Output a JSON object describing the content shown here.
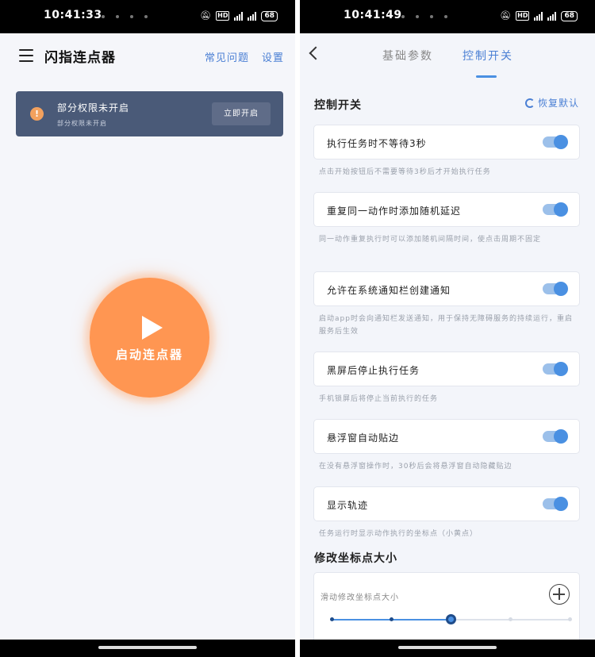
{
  "left": {
    "status": {
      "time": "10:41:33",
      "battery": "68",
      "hd": "HD"
    },
    "header": {
      "title": "闪指连点器",
      "faq": "常见问题",
      "settings": "设置"
    },
    "banner": {
      "title": "部分权限未开启",
      "subtitle": "部分权限未开启",
      "button": "立即开启",
      "icon": "!"
    },
    "start_button": {
      "label": "启动连点器"
    }
  },
  "right": {
    "status": {
      "time": "10:41:49",
      "battery": "68",
      "hd": "HD"
    },
    "tabs": [
      {
        "label": "基础参数"
      },
      {
        "label": "控制开关"
      }
    ],
    "section_control": "控制开关",
    "restore_label": "恢复默认",
    "switches": [
      {
        "label": "执行任务时不等待3秒",
        "desc": "点击开始按钮后不需要等待3秒后才开始执行任务",
        "on": true
      },
      {
        "label": "重复同一动作时添加随机延迟",
        "desc": "同一动作重复执行时可以添加随机间隔时间，使点击周期不固定",
        "on": true
      },
      {
        "label": "允许在系统通知栏创建通知",
        "desc": "启动app时会向通知栏发送通知，用于保持无障碍服务的持续运行，重启服务后生效",
        "on": true
      },
      {
        "label": "黑屏后停止执行任务",
        "desc": "手机锁屏后将停止当前执行的任务",
        "on": true
      },
      {
        "label": "悬浮窗自动贴边",
        "desc": "在没有悬浮窗操作时，30秒后会将悬浮窗自动隐藏贴边",
        "on": true
      },
      {
        "label": "显示轨迹",
        "desc": "任务运行时显示动作执行的坐标点（小黄点）",
        "on": true
      }
    ],
    "section_size": "修改坐标点大小",
    "slider": {
      "label": "滑动修改坐标点大小",
      "steps": 5,
      "selected_step": 3
    },
    "colors": {
      "accent": "#4a90e2",
      "start": "#ff9652",
      "banner": "#4a5a78"
    }
  }
}
